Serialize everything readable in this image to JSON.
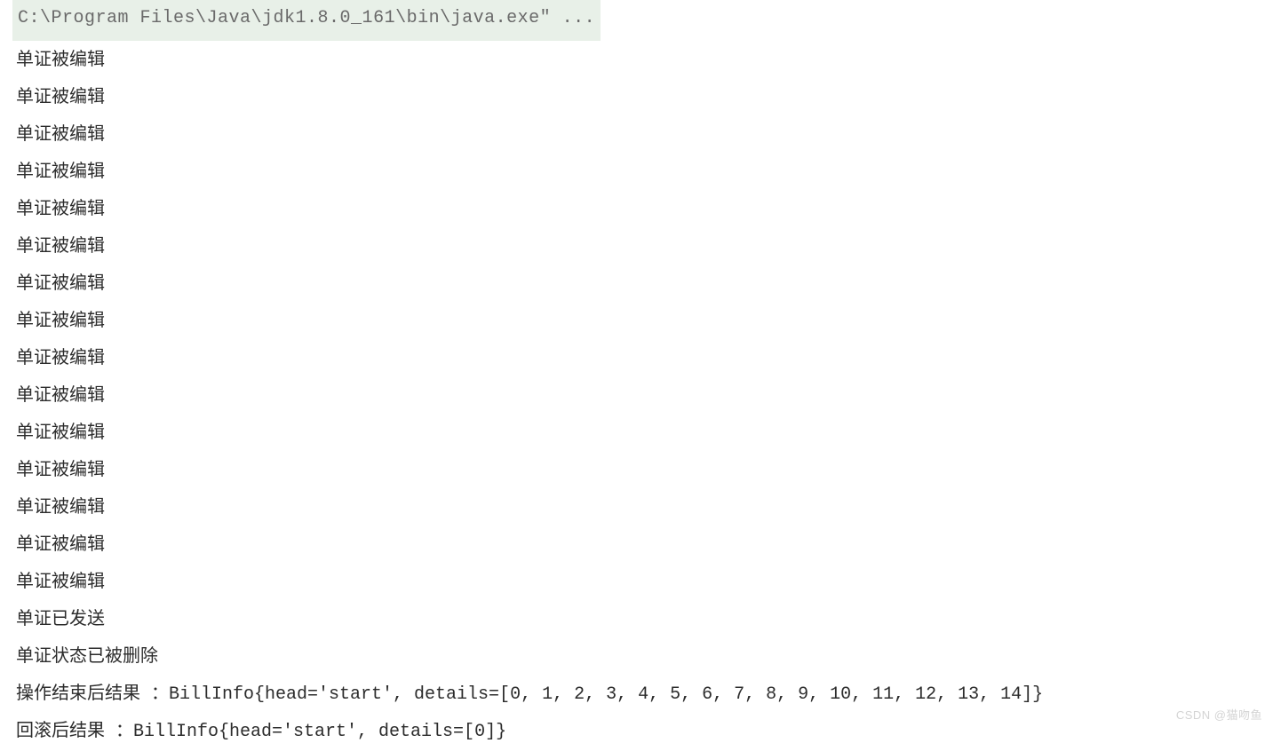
{
  "header": {
    "command": "C:\\Program Files\\Java\\jdk1.8.0_161\\bin\\java.exe\" ..."
  },
  "lines": [
    "单证被编辑",
    "单证被编辑",
    "单证被编辑",
    "单证被编辑",
    "单证被编辑",
    "单证被编辑",
    "单证被编辑",
    "单证被编辑",
    "单证被编辑",
    "单证被编辑",
    "单证被编辑",
    "单证被编辑",
    "单证被编辑",
    "单证被编辑",
    "单证被编辑",
    "单证已发送",
    "单证状态已被删除",
    "操作结束后结果 ：BillInfo{head='start', details=[0, 1, 2, 3, 4, 5, 6, 7, 8, 9, 10, 11, 12, 13, 14]}",
    "回滚后结果 ：BillInfo{head='start', details=[0]}"
  ],
  "watermark": "CSDN @猫吻鱼"
}
